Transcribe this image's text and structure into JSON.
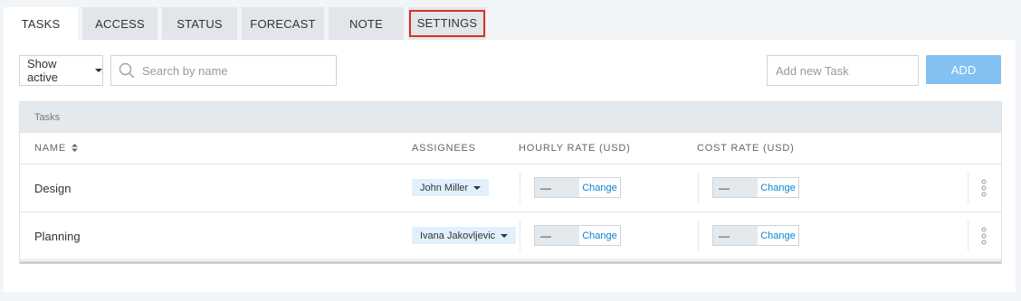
{
  "tabs": [
    {
      "label": "TASKS"
    },
    {
      "label": "ACCESS"
    },
    {
      "label": "STATUS"
    },
    {
      "label": "FORECAST"
    },
    {
      "label": "NOTE"
    },
    {
      "label": "SETTINGS"
    }
  ],
  "filter": {
    "selected": "Show active"
  },
  "search": {
    "placeholder": "Search by name"
  },
  "new_task": {
    "placeholder": "Add new Task",
    "add_label": "ADD"
  },
  "table": {
    "caption": "Tasks",
    "columns": {
      "name": "NAME",
      "assignees": "ASSIGNEES",
      "hourly_rate": "HOURLY RATE (USD)",
      "cost_rate": "COST RATE (USD)"
    },
    "rows": [
      {
        "name": "Design",
        "assignee": "John Miller",
        "hourly_value": "—",
        "hourly_change": "Change",
        "cost_value": "—",
        "cost_change": "Change"
      },
      {
        "name": "Planning",
        "assignee": "Ivana Jakovljevic",
        "hourly_value": "—",
        "hourly_change": "Change",
        "cost_value": "—",
        "cost_change": "Change"
      }
    ]
  },
  "colors": {
    "accent": "#82c1f2",
    "link": "#0b84d3",
    "highlight": "#d9331f",
    "assignee_bg": "#e1f0fc"
  }
}
